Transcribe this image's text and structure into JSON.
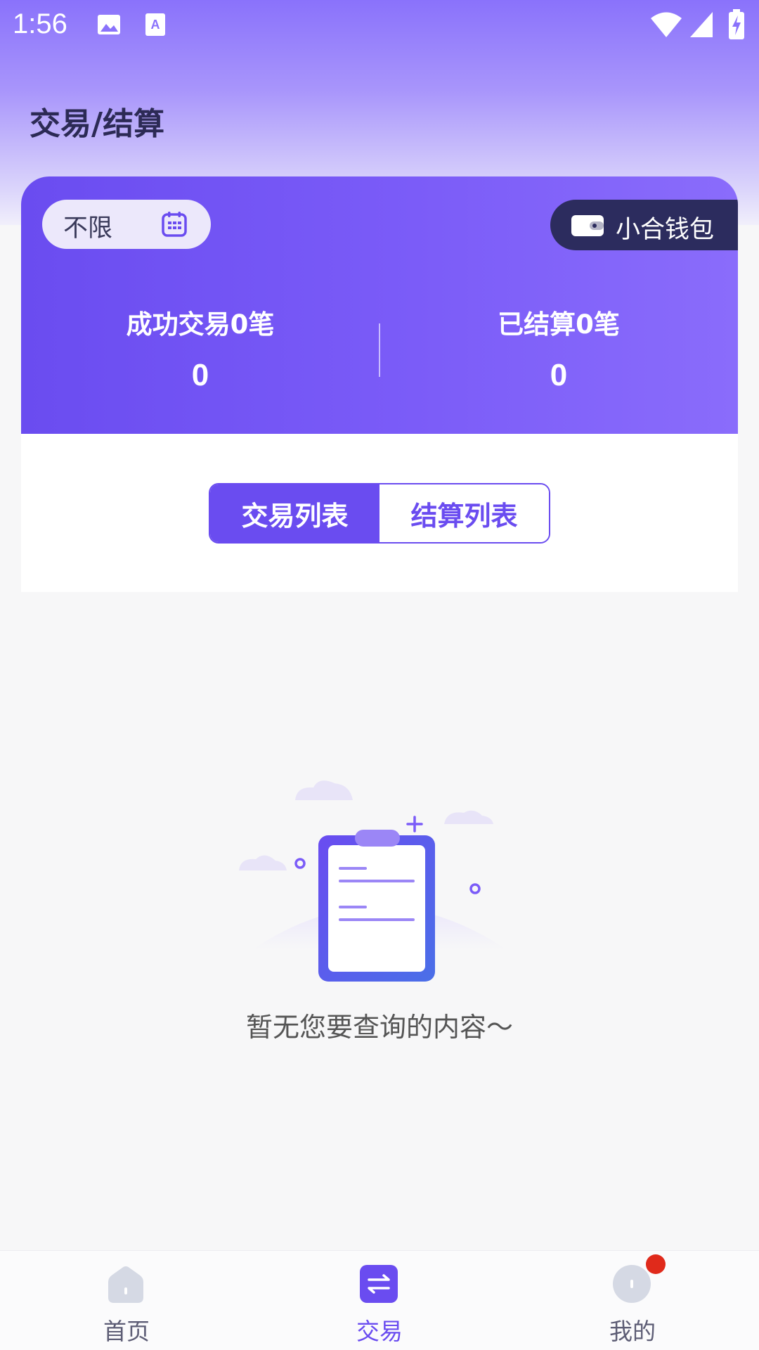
{
  "status_bar": {
    "time": "1:56",
    "icons": [
      "image-icon",
      "text-icon",
      "wifi-icon",
      "signal-icon",
      "battery-charging-icon"
    ]
  },
  "page": {
    "title": "交易/结算"
  },
  "summary": {
    "filter_label": "不限",
    "filter_icon": "calendar-icon",
    "wallet_label": "小合钱包",
    "wallet_icon": "wallet-icon",
    "stats": [
      {
        "title": "成功交易0笔",
        "value": "0"
      },
      {
        "title": "已结算0笔",
        "value": "0"
      }
    ]
  },
  "tabs": [
    {
      "label": "交易列表",
      "active": true
    },
    {
      "label": "结算列表",
      "active": false
    }
  ],
  "empty_state": {
    "message": "暂无您要查询的内容～",
    "illustration": "clipboard-illustration"
  },
  "bottom_nav": {
    "items": [
      {
        "label": "首页",
        "icon": "home-icon",
        "active": false
      },
      {
        "label": "交易",
        "icon": "transfer-icon",
        "active": true
      },
      {
        "label": "我的",
        "icon": "profile-icon",
        "active": false,
        "badge": true
      }
    ]
  },
  "colors": {
    "accent": "#6a4cf0",
    "dark": "#2c2c5e",
    "badge": "#e02a1b",
    "background": "#f7f7f8"
  }
}
